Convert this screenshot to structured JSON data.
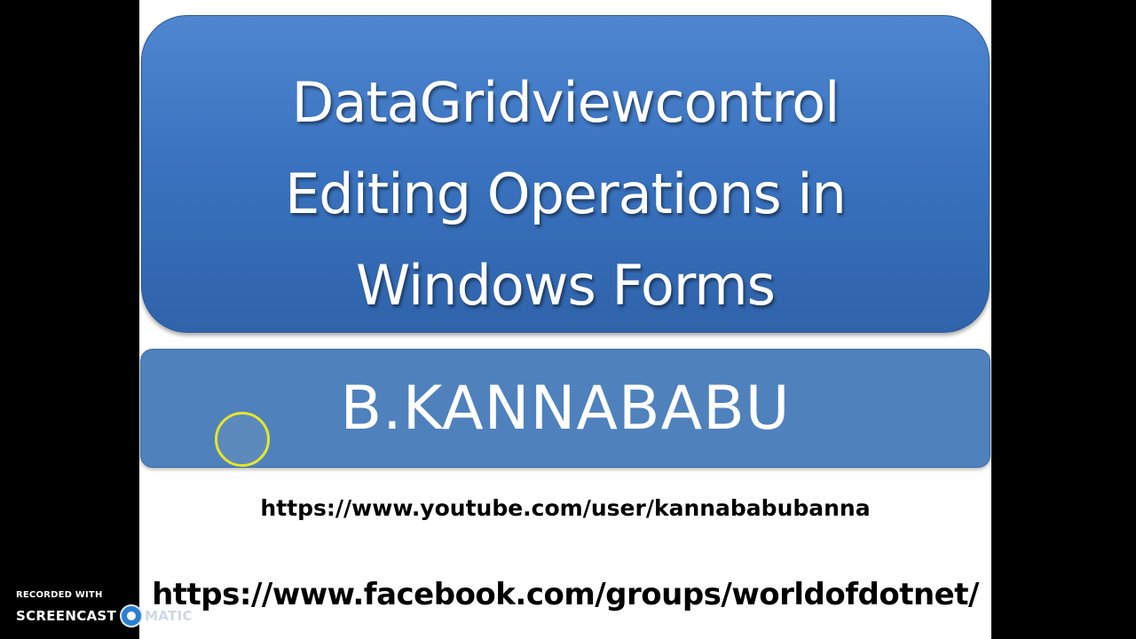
{
  "slide": {
    "title_lines": [
      "DataGridviewcontrol",
      "Editing Operations in",
      "Windows Forms"
    ],
    "author": "B.KANNABABU",
    "links": {
      "youtube": "https://www.youtube.com/user/kannababubanna",
      "facebook": "https://www.facebook.com/groups/worldofdotnet/"
    }
  },
  "watermark": {
    "top_text": "RECORDED WITH",
    "brand_left": "SCREENCAST",
    "brand_right": "MATIC",
    "logo_icon": "screencastomatic-logo-icon"
  },
  "colors": {
    "title_box": "#3a73c0",
    "author_box": "#4f81bd",
    "cursor_highlight": "#e6e62a",
    "background": "#000000",
    "slide": "#ffffff"
  }
}
